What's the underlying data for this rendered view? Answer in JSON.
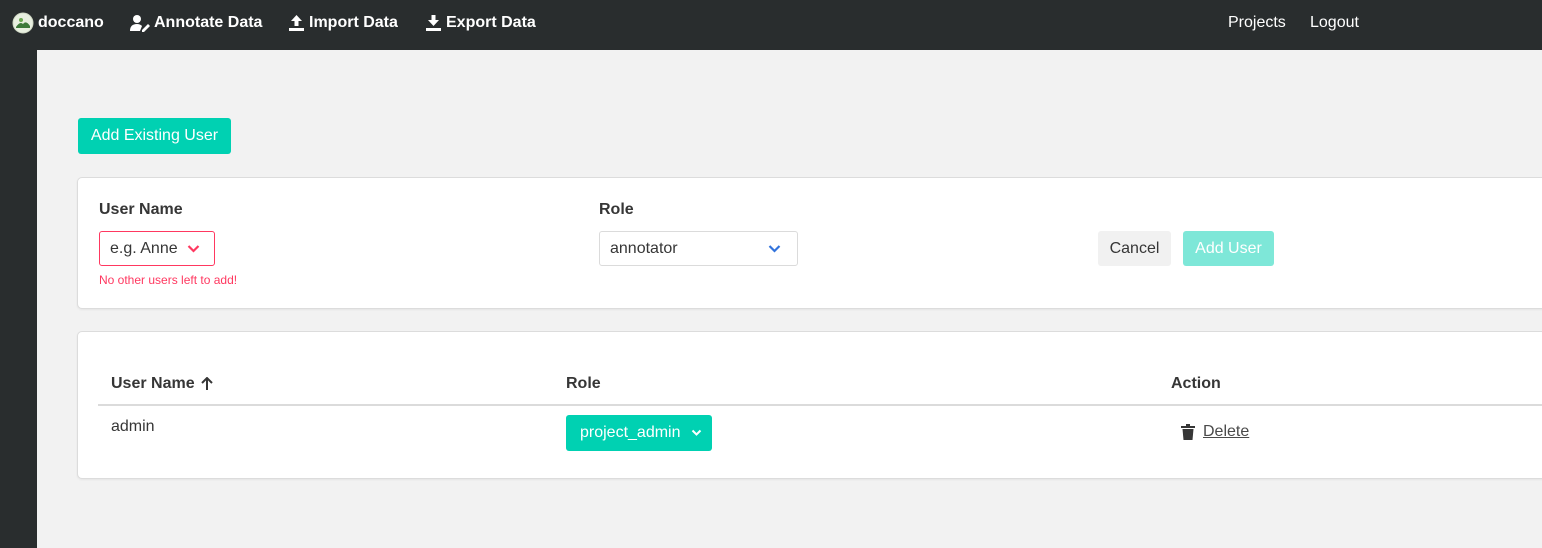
{
  "navbar": {
    "brand": "doccano",
    "annotate": "Annotate Data",
    "import": "Import Data",
    "export": "Export Data",
    "projects": "Projects",
    "logout": "Logout"
  },
  "main": {
    "add_existing_user": "Add Existing User"
  },
  "add_form": {
    "username_label": "User Name",
    "username_placeholder": "e.g. Anne",
    "username_error": "No other users left to add!",
    "role_label": "Role",
    "role_value": "annotator",
    "cancel": "Cancel",
    "add_user": "Add User"
  },
  "members_table": {
    "headers": [
      "User Name",
      "Role",
      "Action"
    ],
    "rows": [
      {
        "username": "admin",
        "role": "project_admin",
        "action": "Delete"
      }
    ]
  },
  "colors": {
    "navbar": "#292d2e",
    "primary": "#00d1b2",
    "danger": "#ff3860",
    "link": "#3273dc"
  }
}
